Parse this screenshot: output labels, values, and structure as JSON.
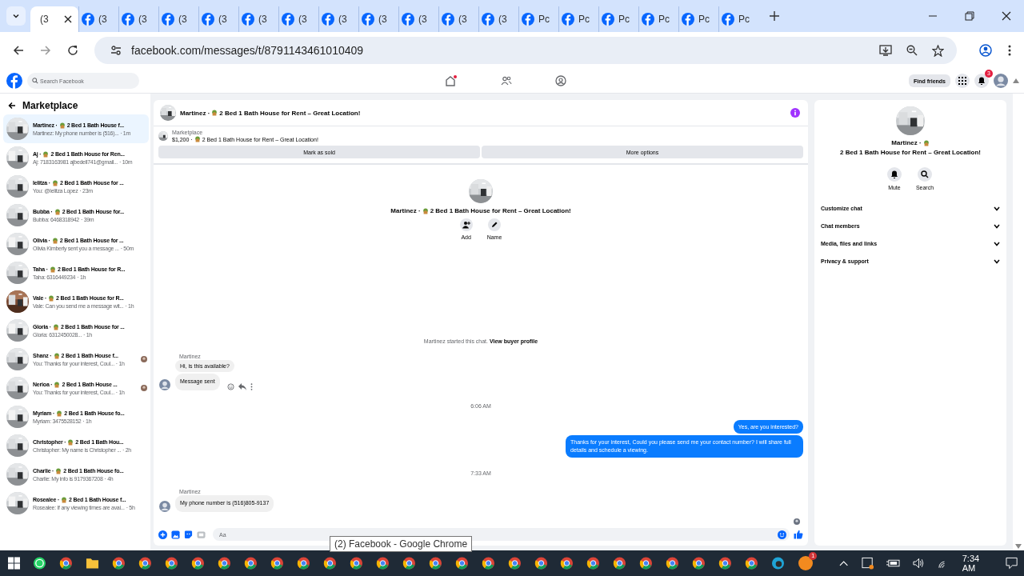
{
  "browser": {
    "tabs": [
      {
        "title": "(3",
        "selected": true,
        "favicon": false
      },
      {
        "title": "(3",
        "selected": false,
        "favicon": true
      },
      {
        "title": "(3",
        "selected": false,
        "favicon": true
      },
      {
        "title": "(3",
        "selected": false,
        "favicon": true
      },
      {
        "title": "(3",
        "selected": false,
        "favicon": true
      },
      {
        "title": "(3",
        "selected": false,
        "favicon": true
      },
      {
        "title": "(3",
        "selected": false,
        "favicon": true
      },
      {
        "title": "(3",
        "selected": false,
        "favicon": true
      },
      {
        "title": "(3",
        "selected": false,
        "favicon": true
      },
      {
        "title": "(3",
        "selected": false,
        "favicon": true
      },
      {
        "title": "(3",
        "selected": false,
        "favicon": true
      },
      {
        "title": "(3",
        "selected": false,
        "favicon": true
      },
      {
        "title": "Pc",
        "selected": false,
        "favicon": true
      },
      {
        "title": "Pc",
        "selected": false,
        "favicon": true
      },
      {
        "title": "Pc",
        "selected": false,
        "favicon": true
      },
      {
        "title": "Pc",
        "selected": false,
        "favicon": true
      },
      {
        "title": "Pc",
        "selected": false,
        "favicon": true
      },
      {
        "title": "Pc",
        "selected": false,
        "favicon": true
      }
    ],
    "url": "facebook.com/messages/t/8791143461010409"
  },
  "facebook_nav": {
    "search_placeholder": "Search Facebook",
    "home_dot": true,
    "find_friends": "Find friends",
    "notification_count": "3"
  },
  "sidebar": {
    "title": "Marketplace",
    "conversations": [
      {
        "name": "Martinez ·",
        "title": "2 Bed 1 Bath House f...",
        "preview": "Martinez: My phone number is (516)...",
        "time": "· 1m",
        "selected": true,
        "seen": false
      },
      {
        "name": "Aj ·",
        "title": "2 Bed 1 Bath House for Ren...",
        "preview": "Aj: 7183163981 ajbedell741@gmail...",
        "time": "· 10m",
        "selected": false,
        "seen": false
      },
      {
        "name": "Ielitza ·",
        "title": "2 Bed 1 Bath House for ...",
        "preview": "You: @Ielitza Lopez",
        "time": "· 23m",
        "selected": false,
        "seen": false
      },
      {
        "name": "Bubba ·",
        "title": "2 Bed 1 Bath House for...",
        "preview": "Bubba: 6468318942",
        "time": "· 39m",
        "selected": false,
        "seen": false
      },
      {
        "name": "Olivia ·",
        "title": "2 Bed 1 Bath House for ...",
        "preview": "Olivia Kimberly sent you a message ...",
        "time": "· 50m",
        "selected": false,
        "seen": false
      },
      {
        "name": "Taha ·",
        "title": "2 Bed 1 Bath House for R...",
        "preview": "Taha: 6316449234",
        "time": "· 1h",
        "selected": false,
        "seen": false
      },
      {
        "name": "Vale ·",
        "title": "2 Bed 1 Bath House for R...",
        "preview": "Vale: Can you send me a message wit...",
        "time": "· 1h",
        "selected": false,
        "seen": false
      },
      {
        "name": "Gloria ·",
        "title": "2 Bed 1 Bath House for ...",
        "preview": "Gloria: 6312450028...",
        "time": "· 1h",
        "selected": false,
        "seen": false
      },
      {
        "name": "Shanz ·",
        "title": "2 Bed 1 Bath House f...",
        "preview": "You: Thanks for your interest, Coul...",
        "time": "· 1h",
        "selected": false,
        "seen": true
      },
      {
        "name": "Nerioa ·",
        "title": "2 Bed 1 Bath House ...",
        "preview": "You: Thanks for your interest, Coul...",
        "time": "· 1h",
        "selected": false,
        "seen": true
      },
      {
        "name": "Myriam ·",
        "title": "2 Bed 1 Bath House fo...",
        "preview": "Myriam: 3475528152",
        "time": "· 1h",
        "selected": false,
        "seen": false
      },
      {
        "name": "Christopher ·",
        "title": "2 Bed 1 Bath Hou...",
        "preview": "Christopher: My name is Christopher ...",
        "time": "· 2h",
        "selected": false,
        "seen": false
      },
      {
        "name": "Charlie ·",
        "title": "2 Bed 1 Bath House fo...",
        "preview": "Charlie: My info is 9179367208",
        "time": "· 4h",
        "selected": false,
        "seen": false
      },
      {
        "name": "Rosealee ·",
        "title": "2 Bed 1 Bath House f...",
        "preview": "Rosealee: If any viewing times are avai...",
        "time": "· 5h",
        "selected": false,
        "seen": false
      }
    ]
  },
  "chat": {
    "header": {
      "name": "Martinez ·",
      "title": "2 Bed 1 Bath House for Rent – Great Location!"
    },
    "profile": {
      "name": "Martinez ·",
      "title": "2 Bed 1 Bath House for Rent – Great Location!"
    },
    "listing": {
      "label": "Marketplace",
      "price": "$1,200 ·",
      "title": "2 Bed 1 Bath House for Rent – Great Location!",
      "buttons": [
        "Mark as sold",
        "More options"
      ]
    },
    "profile_actions": [
      "Add",
      "Name"
    ],
    "started_text": "Martinez started this chat.",
    "profile_link": "View buyer profile",
    "messages": [
      {
        "kind": "sender",
        "text": "Martinez"
      },
      {
        "kind": "incoming",
        "text": "Hi, is this available?",
        "avatar": false,
        "actions": false
      },
      {
        "kind": "incoming",
        "text": "Message sent",
        "avatar": true,
        "actions": true
      },
      {
        "kind": "time",
        "text": "6:06 AM"
      },
      {
        "kind": "outgoing",
        "text": "Yes, are you interested?"
      },
      {
        "kind": "outgoing",
        "text": "Thanks for your interest, Could you please send me your contact number? I will share full details and schedule a viewing."
      },
      {
        "kind": "time",
        "text": "7:33 AM"
      },
      {
        "kind": "sender",
        "text": "Martinez"
      },
      {
        "kind": "incoming",
        "text": "My phone number is (516)805-9137",
        "avatar": true,
        "actions": false
      }
    ],
    "seen": true,
    "composer_placeholder": "Aa"
  },
  "details": {
    "name": "Martinez ·",
    "title": "2 Bed 1 Bath House for Rent – Great Location!",
    "actions": [
      "Mute",
      "Search"
    ],
    "sections": [
      {
        "label": "Customize chat",
        "expanded": false
      },
      {
        "label": "Chat members",
        "expanded": false
      },
      {
        "label": "Media, files and links",
        "expanded": false
      },
      {
        "label": "Privacy & support",
        "expanded": false
      }
    ]
  },
  "tooltip": "(2) Facebook - Google Chrome",
  "taskbar": {
    "badge": "1",
    "time": "7:34 AM"
  }
}
